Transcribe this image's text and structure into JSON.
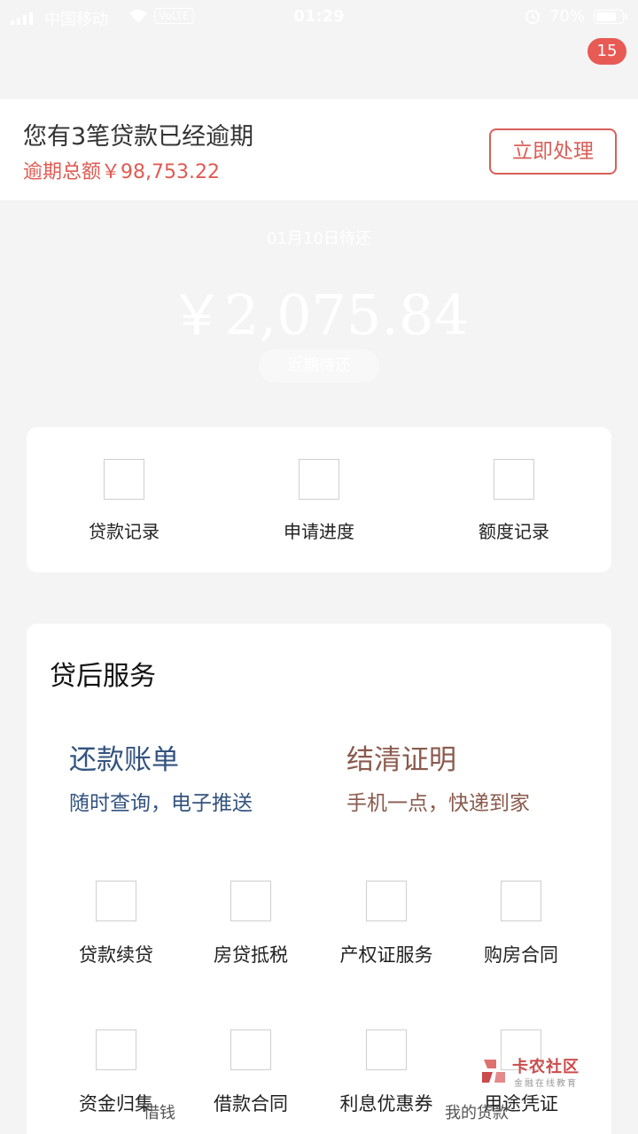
{
  "status_bar": {
    "carrier": "中国移动",
    "volte": "VoLTE",
    "time": "01:29",
    "battery": "70%"
  },
  "badge": {
    "count": "15"
  },
  "overdue": {
    "title": "您有3笔贷款已经逾期",
    "amount": "逾期总额￥98,753.22",
    "action_label": "立即处理"
  },
  "repay": {
    "due_label": "01月10日待还",
    "due_amount": "￥2,075.84",
    "recent_label": "近期待还"
  },
  "quick_entries": [
    {
      "label": "贷款记录"
    },
    {
      "label": "申请进度"
    },
    {
      "label": "额度记录"
    }
  ],
  "services": {
    "title": "贷后服务",
    "features": [
      {
        "title": "还款账单",
        "subtitle": "随时查询，电子推送",
        "color": "#33537f"
      },
      {
        "title": "结清证明",
        "subtitle": "手机一点，快递到家",
        "color": "#8a5a4c"
      }
    ],
    "grid": [
      {
        "label": "贷款续贷"
      },
      {
        "label": "房贷抵税"
      },
      {
        "label": "产权证服务"
      },
      {
        "label": "购房合同"
      },
      {
        "label": "资金归集"
      },
      {
        "label": "借款合同"
      },
      {
        "label": "利息优惠券"
      },
      {
        "label": "用途凭证"
      }
    ]
  },
  "tab_bar": {
    "borrow": "借钱",
    "my_loans": "我的贷款"
  },
  "watermark": {
    "title": "卡农社区",
    "subtitle": "金融在线教育"
  },
  "colors": {
    "accent_red": "#e05a52",
    "badge_red": "#e85a54",
    "background": "#f4f4f4"
  }
}
